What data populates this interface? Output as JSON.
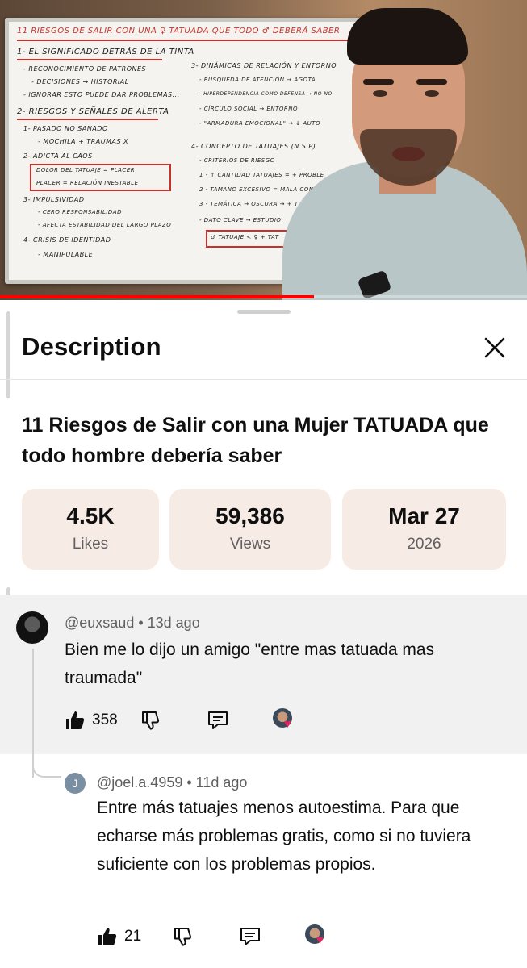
{
  "video": {
    "progress_fraction": 0.595,
    "whiteboard": {
      "title": "11 RIESGOS DE SALIR CON UNA ♀ TATUADA QUE TODO ♂ DEBERÁ SABER",
      "lines": [
        "1- EL SIGNIFICADO DETRÁS DE LA TINTA",
        "- RECONOCIMIENTO DE PATRONES",
        "- DECISIONES → HISTORIAL",
        "- IGNORAR ESTO PUEDE DAR PROBLEMAS...",
        "2- RIESGOS Y SEÑALES DE ALERTA",
        "1- PASADO NO SANADO",
        "- MOCHILA + TRAUMAS X",
        "2- ADICTA AL CAOS",
        "DOLOR DEL TATUAJE = PLACER",
        "PLACER = RELACIÓN INESTABLE",
        "3- IMPULSIVIDAD",
        "- CERO RESPONSABILIDAD",
        "- AFECTA ESTABILIDAD DEL LARGO PLAZO",
        "4- CRISIS DE IDENTIDAD",
        "- MANIPULABLE",
        "3- DINÁMICAS DE RELACIÓN Y ENTORNO",
        "- BÚSQUEDA DE ATENCIÓN → AGOTA",
        "- HIPERDEPENDENCIA COMO DEFENSA → NO NO",
        "- CÍRCULO SOCIAL → ENTORNO",
        "- \"ARMADURA EMOCIONAL\" → ↓ AUTO",
        "4- CONCEPTO DE TATUAJES (N.S.P)",
        "- CRITERIOS DE RIESGO",
        "1 - ↑ CANTIDAD TATUAJES = + PROBLE",
        "2 - TAMAÑO EXCESIVO = MALA CONDU",
        "3 - TEMÁTICA → OSCURA → + T",
        "- DATO CLAVE → ESTUDIO",
        "♂ TATUAJE < ♀ + TAT"
      ]
    }
  },
  "sheet": {
    "title": "Description",
    "close_icon": "close-icon",
    "video_title": "11 Riesgos de Salir con una Mujer TATUADA que todo hombre debería saber",
    "stats": [
      {
        "value": "4.5K",
        "label": "Likes"
      },
      {
        "value": "59,386",
        "label": "Views"
      },
      {
        "value": "Mar 27",
        "label": "2026"
      }
    ]
  },
  "comments": [
    {
      "author": "@euxsaud",
      "age": "13d ago",
      "text": "Bien me lo dijo un amigo \"entre mas tatuada mas traumada\"",
      "likes": "358",
      "hearted": true
    },
    {
      "author": "@joel.a.4959",
      "age": "11d ago",
      "avatar_letter": "J",
      "text": "Entre más tatuajes menos autoestima. Para que echarse más problemas gratis, como si no tuviera suficiente con los problemas propios.",
      "likes": "21",
      "hearted": true
    }
  ],
  "colors": {
    "accent_red": "#ff0000",
    "stat_bg": "#f7ebe5",
    "highlight_comment_bg": "#f1f1f1",
    "heart": "#e0245e",
    "reply_avatar": "#7b8fa3"
  }
}
